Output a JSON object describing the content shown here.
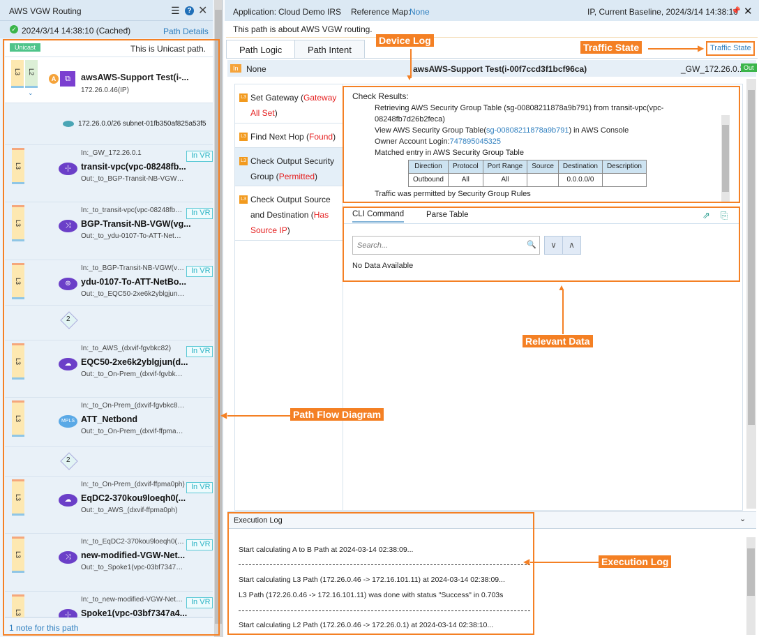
{
  "left": {
    "title": "AWS VGW Routing",
    "timestamp": "2024/3/14 14:38:10 (Cached)",
    "path_details": "Path Details",
    "unicast_badge": "Unicast",
    "unicast_text": "This is Unicast path.",
    "source": {
      "badge": "A",
      "name": "awsAWS-Support Test(i-...",
      "ip": "172.26.0.46(IP)",
      "layers": [
        "L3",
        "L2"
      ]
    },
    "subnet": "172.26.0.0/26 subnet-01fb350af825a53f5",
    "nodes": [
      {
        "in": "In:_GW_172.26.0.1",
        "name": "transit-vpc(vpc-08248fb...",
        "out": "Out:_to_BGP-Transit-NB-VGW(vgw-...",
        "icon": "router-icon",
        "glyph": "-|-",
        "vr": "In VR"
      },
      {
        "in": "In:_to_transit-vpc(vpc-08248fb7d2...",
        "name": "BGP-Transit-NB-VGW(vg...",
        "out": "Out:_to_ydu-0107-To-ATT-NetBond(...",
        "icon": "vgw-icon",
        "glyph": "⤨",
        "vr": "In VR"
      },
      {
        "in": "In:_to_BGP-Transit-NB-VGW(vgw-...",
        "name": "ydu-0107-To-ATT-NetBo...",
        "out": "Out:_to_EQC50-2xe6k2yblgjun(dxco...",
        "icon": "gateway-icon",
        "glyph": "⊕",
        "vr": "In VR"
      },
      {
        "in": "In:_to_AWS_(dxvif-fgvbkc82)",
        "name": "EQC50-2xe6k2yblgjun(d...",
        "out": "Out:_to_On-Prem_(dxvif-fgvbkc82)",
        "icon": "direct-connect-icon",
        "glyph": "☁",
        "vr": "In VR"
      },
      {
        "in": "In:_to_On-Prem_(dxvif-fgvbkc82)-...",
        "name": "ATT_Netbond",
        "out": "Out:_to_On-Prem_(dxvif-ffpma0ph)-...",
        "icon": "mpls-cloud-icon",
        "glyph": "MPLS",
        "vr": ""
      },
      {
        "in": "In:_to_On-Prem_(dxvif-ffpma0ph)",
        "name": "EqDC2-370kou9loeqh0(...",
        "out": "Out:_to_AWS_(dxvif-ffpma0ph)",
        "icon": "direct-connect-icon",
        "glyph": "☁",
        "vr": "In VR"
      },
      {
        "in": "In:_to_EqDC2-370kou9loeqh0(dxc...",
        "name": "new-modified-VGW-Net...",
        "out": "Out:_to_Spoke1(vpc-03bf7347a44ae...",
        "icon": "vgw-icon",
        "glyph": "⤨",
        "vr": "In VR"
      },
      {
        "in": "In:_to_new-modified-VGW-Netbo...",
        "name": "Spoke1(vpc-03bf7347a4...",
        "out": "",
        "icon": "router-icon",
        "glyph": "-|-",
        "vr": "In VR"
      }
    ],
    "layer_label": "L3",
    "hop_count": "2",
    "footer": "1 note for this path"
  },
  "header": {
    "app_label": "Application:",
    "app": "Cloud Demo IRS",
    "map_label": "Reference Map:",
    "map": "None",
    "baseline": "IP, Current Baseline, 2024/3/14 14:38:10"
  },
  "description": "This path is about AWS VGW routing.",
  "tabs": [
    "Path Logic",
    "Path Intent"
  ],
  "traffic_state": "Traffic State",
  "info": {
    "in_tag": "In",
    "in_value": "None",
    "device": "awsAWS-Support Test(i-00f7ccd3f1bcf96ca)",
    "out_value": "_GW_172.26.0.1",
    "out_tag": "Out"
  },
  "steps": [
    {
      "badge": "L3",
      "label": "Set Gateway (",
      "status": "Gateway All Set",
      "end": ")"
    },
    {
      "badge": "L3",
      "label": "Find Next Hop (",
      "status": "Found",
      "end": ")"
    },
    {
      "badge": "L3",
      "label": "Check Output Security Group (",
      "status": "Permitted",
      "end": ")"
    },
    {
      "badge": "L3",
      "label": "Check Output Source and Destination (",
      "status": "Has Source IP",
      "end": ")"
    }
  ],
  "device_log": {
    "title": "Check Results:",
    "item1": "Retrieving AWS Security Group Table (sg-00808211878a9b791) from transit-vpc(vpc-08248fb7d26b2feca)",
    "item2_pre": "View AWS Security Group Table(",
    "item2_link": "sg-00808211878a9b791",
    "item2_post": ") in AWS Console",
    "item3_pre": "Owner Account Login:",
    "item3_link": "747895045325",
    "item4": "Matched entry in AWS Security Group Table",
    "table_headers": [
      "Direction",
      "Protocol",
      "Port Range",
      "Source",
      "Destination",
      "Description"
    ],
    "table_row": [
      "Outbound",
      "All",
      "All",
      "",
      "0.0.0.0/0",
      ""
    ],
    "item5": "Traffic was permitted by Security Group Rules"
  },
  "relevant": {
    "tabs": [
      "CLI Command",
      "Parse Table"
    ],
    "search_placeholder": "Search...",
    "empty": "No Data Available"
  },
  "exec_log": {
    "title": "Execution Log",
    "lines": [
      "Start calculating A to B Path at 2024-03-14 02:38:09...",
      "Start calculating L3 Path (172.26.0.46 -> 172.16.101.11) at 2024-03-14 02:38:09...",
      "L3 Path (172.26.0.46 -> 172.16.101.11) was done with status \"Success\" in 0.703s",
      "Start calculating L2 Path (172.26.0.46 -> 172.26.0.1) at 2024-03-14 02:38:10..."
    ]
  },
  "annotations": {
    "device_log": "Device Log",
    "traffic_state": "Traffic State",
    "relevant_data": "Relevant Data",
    "path_flow": "Path Flow Diagram",
    "execution_log": "Execution Log"
  },
  "colors": {
    "accent": "#f48024",
    "link": "#2f7fbf",
    "status_red": "#e52121",
    "node_purple": "#6b3fc8"
  }
}
